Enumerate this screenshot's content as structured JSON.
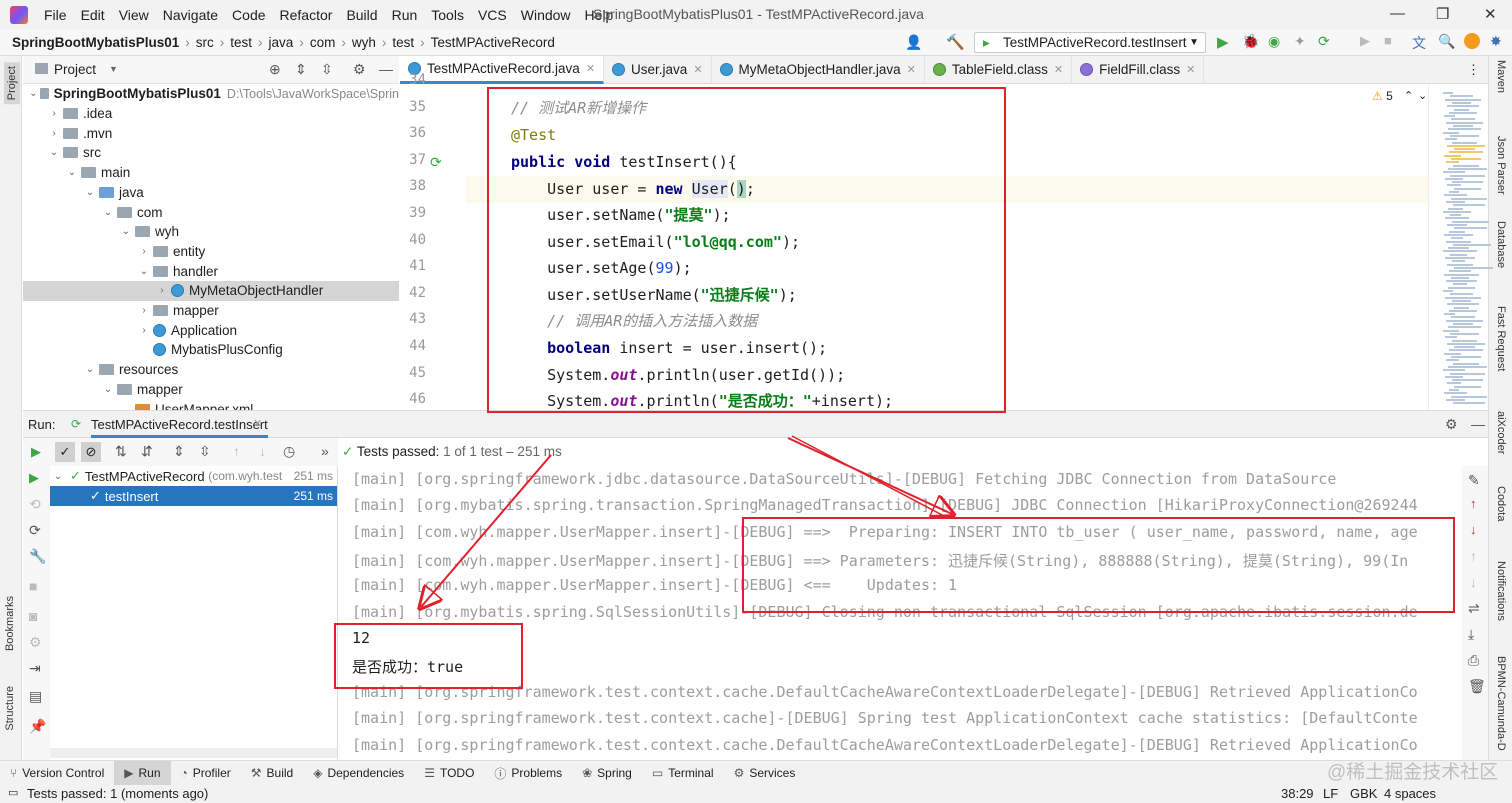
{
  "menubar": {
    "items": [
      "File",
      "Edit",
      "View",
      "Navigate",
      "Code",
      "Refactor",
      "Build",
      "Run",
      "Tools",
      "VCS",
      "Window",
      "Help"
    ],
    "title": "SpringBootMybatisPlus01 - TestMPActiveRecord.java"
  },
  "breadcrumb": [
    "SpringBootMybatisPlus01",
    "src",
    "test",
    "java",
    "com",
    "wyh",
    "test",
    "TestMPActiveRecord"
  ],
  "run_config": "TestMPActiveRecord.testInsert",
  "project": {
    "header": "Project",
    "tree": [
      {
        "label": "SpringBootMybatisPlus01",
        "extra": "D:\\Tools\\JavaWorkSpace\\Sprin",
        "depth": 0,
        "type": "folder",
        "open": true
      },
      {
        "label": ".idea",
        "depth": 1,
        "type": "folder",
        "open": false
      },
      {
        "label": ".mvn",
        "depth": 1,
        "type": "folder",
        "open": false
      },
      {
        "label": "src",
        "depth": 1,
        "type": "folder",
        "open": true
      },
      {
        "label": "main",
        "depth": 2,
        "type": "folder",
        "open": true
      },
      {
        "label": "java",
        "depth": 3,
        "type": "folder-blue",
        "open": true
      },
      {
        "label": "com",
        "depth": 4,
        "type": "folder",
        "open": true
      },
      {
        "label": "wyh",
        "depth": 5,
        "type": "folder",
        "open": true
      },
      {
        "label": "entity",
        "depth": 6,
        "type": "folder",
        "open": false
      },
      {
        "label": "handler",
        "depth": 6,
        "type": "folder",
        "open": true
      },
      {
        "label": "MyMetaObjectHandler",
        "depth": 7,
        "type": "class",
        "open": false,
        "selected": true
      },
      {
        "label": "mapper",
        "depth": 6,
        "type": "folder",
        "open": false
      },
      {
        "label": "Application",
        "depth": 6,
        "type": "class",
        "open": false
      },
      {
        "label": "MybatisPlusConfig",
        "depth": 6,
        "type": "class",
        "leaf": true
      },
      {
        "label": "resources",
        "depth": 3,
        "type": "folder",
        "open": true
      },
      {
        "label": "mapper",
        "depth": 4,
        "type": "folder",
        "open": true
      },
      {
        "label": "UserMapper.xml",
        "depth": 5,
        "type": "file",
        "leaf": true
      }
    ]
  },
  "tabs": [
    {
      "label": "TestMPActiveRecord.java",
      "icon": "class",
      "active": true
    },
    {
      "label": "User.java",
      "icon": "class"
    },
    {
      "label": "MyMetaObjectHandler.java",
      "icon": "class"
    },
    {
      "label": "TableField.class",
      "icon": "annotation"
    },
    {
      "label": "FieldFill.class",
      "icon": "enum"
    }
  ],
  "editor": {
    "warnings": "5",
    "line_numbers": [
      "34",
      "35",
      "36",
      "37",
      "38",
      "39",
      "40",
      "41",
      "42",
      "43",
      "44",
      "45",
      "46"
    ]
  },
  "run": {
    "label": "Run:",
    "tab": "TestMPActiveRecord.testInsert",
    "tests_passed": "Tests passed:",
    "tests_count": "1 of 1 test – 251 ms",
    "tree": [
      {
        "label": "TestMPActiveRecord",
        "sub": "(com.wyh.test",
        "time": "251 ms"
      },
      {
        "label": "testInsert",
        "time": "251 ms"
      }
    ],
    "console": [
      "[main] [org.springframework.jdbc.datasource.DataSourceUtils]-[DEBUG] Fetching JDBC Connection from DataSource",
      "[main] [org.mybatis.spring.transaction.SpringManagedTransaction]-[DEBUG] JDBC Connection [HikariProxyConnection@269244",
      "[main] [com.wyh.mapper.UserMapper.insert]-[DEBUG] ==>  Preparing: INSERT INTO tb_user ( user_name, password, name, age",
      "[main] [com.wyh.mapper.UserMapper.insert]-[DEBUG] ==> Parameters: 迅捷斥候(String), 888888(String), 提莫(String), 99(In",
      "[main] [com.wyh.mapper.UserMapper.insert]-[DEBUG] <==    Updates: 1",
      "[main] [org.mybatis.spring.SqlSessionUtils]-[DEBUG] Closing non transactional SqlSession [org.apache.ibatis.session.de",
      "12",
      "是否成功：true",
      "[main] [org.springframework.test.context.cache.DefaultCacheAwareContextLoaderDelegate]-[DEBUG] Retrieved ApplicationCo",
      "[main] [org.springframework.test.context.cache]-[DEBUG] Spring test ApplicationContext cache statistics: [DefaultConte",
      "[main] [org.springframework.test.context.cache.DefaultCacheAwareContextLoaderDelegate]-[DEBUG] Retrieved ApplicationCo"
    ]
  },
  "bottom_tools": [
    "Version Control",
    "Run",
    "Profiler",
    "Build",
    "Dependencies",
    "TODO",
    "Problems",
    "Spring",
    "Terminal",
    "Services"
  ],
  "status": {
    "left": "Tests passed: 1 (moments ago)",
    "pos": "38:29",
    "sep": "LF",
    "enc": "GBK",
    "indent": "4 spaces"
  },
  "left_stripe": [
    "Project",
    "Bookmarks",
    "Structure"
  ],
  "right_stripe": [
    "Maven",
    "Json Parser",
    "Database",
    "Fast Request",
    "aiXcoder",
    "Codota",
    "Notifications",
    "BPMN-Camunda-D"
  ],
  "watermark": "@稀土掘金技术社区",
  "colors": {
    "accent": "#4083c9",
    "annotation_red": "#e0202a",
    "pass_green": "#3fa644"
  }
}
